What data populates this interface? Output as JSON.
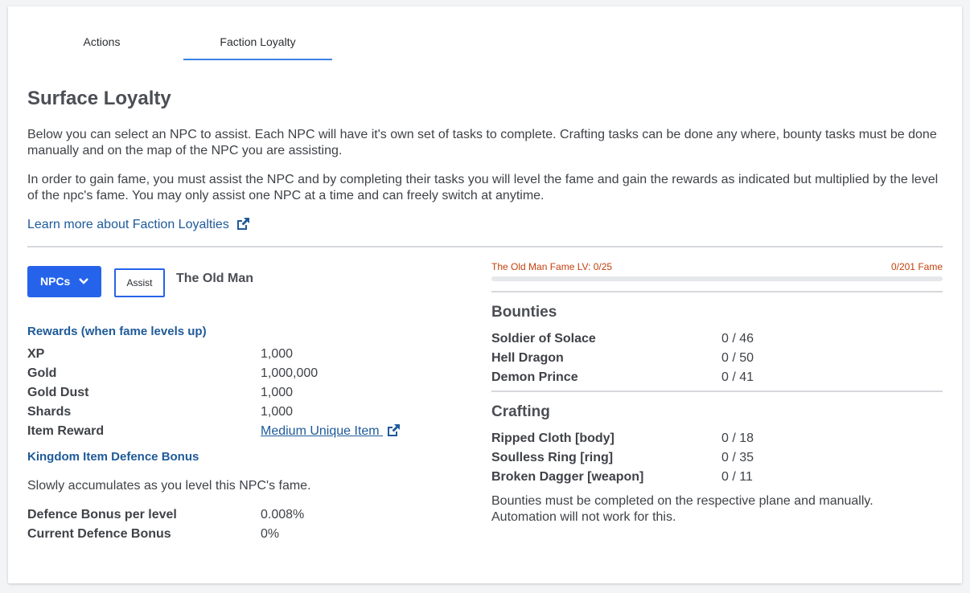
{
  "tabs": [
    {
      "label": "Actions"
    },
    {
      "label": "Faction Loyalty"
    }
  ],
  "page": {
    "title": "Surface Loyalty",
    "intro1": "Below you can select an NPC to assist. Each NPC will have it's own set of tasks to complete. Crafting tasks can be done any where, bounty tasks must be done manually and on the map of the NPC you are assisting.",
    "intro2": "In order to gain fame, you must assist the NPC and by completing their tasks you will level the fame and gain the rewards as indicated but multiplied by the level of the npc's fame. You may only assist one NPC at a time and can freely switch at anytime.",
    "learn_more": "Learn more about Faction Loyalties"
  },
  "controls": {
    "npcs_label": "NPCs",
    "assist_label": "Assist",
    "npc_name": "The Old Man"
  },
  "rewards": {
    "title": "Rewards (when fame levels up)",
    "rows": [
      {
        "label": "XP",
        "value": "1,000"
      },
      {
        "label": "Gold",
        "value": "1,000,000"
      },
      {
        "label": "Gold Dust",
        "value": "1,000"
      },
      {
        "label": "Shards",
        "value": "1,000"
      },
      {
        "label": "Item Reward",
        "value": "Medium Unique Item"
      }
    ]
  },
  "defence": {
    "title": "Kingdom Item Defence Bonus",
    "description": "Slowly accumulates as you level this NPC's fame.",
    "rows": [
      {
        "label": "Defence Bonus per level",
        "value": "0.008%"
      },
      {
        "label": "Current Defence Bonus",
        "value": "0%"
      }
    ]
  },
  "fame": {
    "label": "The Old Man Fame LV: 0/25",
    "count": "0/201 Fame",
    "progress": 0,
    "color": "#c2410c"
  },
  "bounties": {
    "title": "Bounties",
    "rows": [
      {
        "label": "Soldier of Solace",
        "value": "0 / 46"
      },
      {
        "label": "Hell Dragon",
        "value": "0 / 50"
      },
      {
        "label": "Demon Prince",
        "value": "0 / 41"
      }
    ]
  },
  "crafting": {
    "title": "Crafting",
    "rows": [
      {
        "label": "Ripped Cloth [body]",
        "value": "0 / 18"
      },
      {
        "label": "Soulless Ring [ring]",
        "value": "0 / 35"
      },
      {
        "label": "Broken Dagger [weapon]",
        "value": "0 / 11"
      }
    ]
  },
  "note": "Bounties must be completed on the respective plane and manually. Automation will not work for this.",
  "colors": {
    "primary": "#2563eb",
    "link": "#1e5a99",
    "fame": "#c2410c"
  }
}
